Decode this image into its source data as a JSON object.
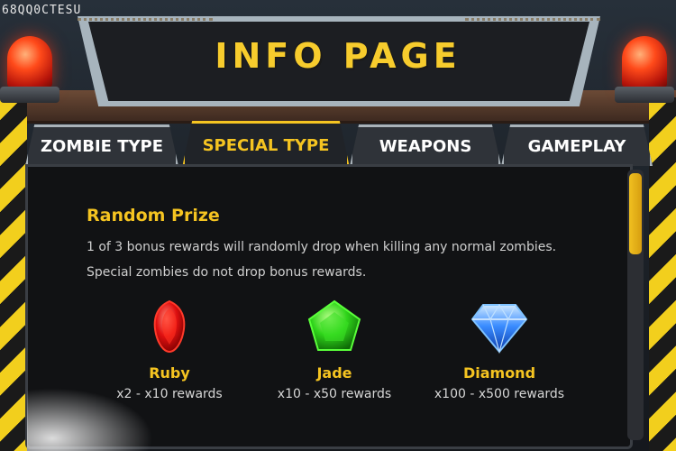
{
  "scene": {
    "corner_id": "68QQ0CTESU"
  },
  "header": {
    "title": "INFO PAGE"
  },
  "tabs": [
    {
      "label": "ZOMBIE TYPE",
      "active": false
    },
    {
      "label": "SPECIAL TYPE",
      "active": true
    },
    {
      "label": "WEAPONS",
      "active": false
    },
    {
      "label": "GAMEPLAY",
      "active": false
    }
  ],
  "content": {
    "section_title": "Random Prize",
    "lines": [
      "1 of 3 bonus rewards will randomly drop when killing any normal zombies.",
      "Special zombies do not drop bonus rewards."
    ],
    "prizes": [
      {
        "name": "Ruby",
        "reward": "x2 - x10 rewards",
        "icon": "ruby-gem-icon"
      },
      {
        "name": "Jade",
        "reward": "x10 - x50 rewards",
        "icon": "jade-gem-icon"
      },
      {
        "name": "Diamond",
        "reward": "x100 - x500 rewards",
        "icon": "diamond-gem-icon"
      }
    ]
  },
  "scroll": {
    "position_fraction": 0.0
  },
  "colors": {
    "accent": "#f5c421",
    "hazard_yellow": "#f2cf1d",
    "panel": "#111214"
  }
}
